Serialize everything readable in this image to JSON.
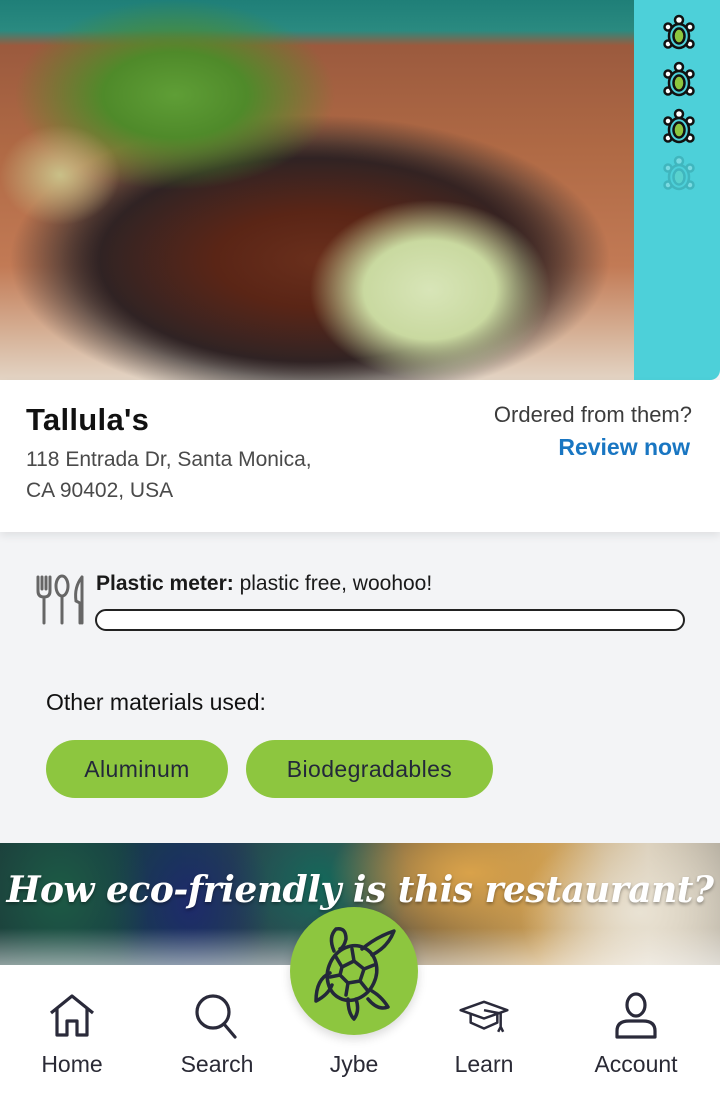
{
  "restaurant": {
    "name": "Tallula's",
    "address_line1": "118 Entrada Dr, Santa Monica,",
    "address_line2": "CA 90402, USA",
    "image_icon": "food-photo",
    "rating": {
      "icon": "turtle-icon",
      "score": 3,
      "max": 4
    }
  },
  "review_prompt": {
    "question": "Ordered from them?",
    "link_label": "Review now"
  },
  "plastic_meter": {
    "icon": "utensils-icon",
    "label": "Plastic meter:",
    "value_text": "plastic free, woohoo!",
    "level_percent": 0
  },
  "materials": {
    "title": "Other materials used:",
    "chips": [
      "Aluminum",
      "Biodegradables"
    ]
  },
  "banner": {
    "title": "How eco-friendly is this restaurant?"
  },
  "bottom_nav": {
    "items": [
      {
        "label": "Home",
        "icon": "home-icon"
      },
      {
        "label": "Search",
        "icon": "search-icon"
      },
      {
        "label": "Jybe",
        "icon": "turtle-icon"
      },
      {
        "label": "Learn",
        "icon": "graduation-cap-icon"
      },
      {
        "label": "Account",
        "icon": "user-icon"
      }
    ]
  },
  "colors": {
    "accent_green": "#8dc63f",
    "rating_strip": "#4dd0d9",
    "link_blue": "#1976c2",
    "icon_dark": "#2a2a3a"
  }
}
